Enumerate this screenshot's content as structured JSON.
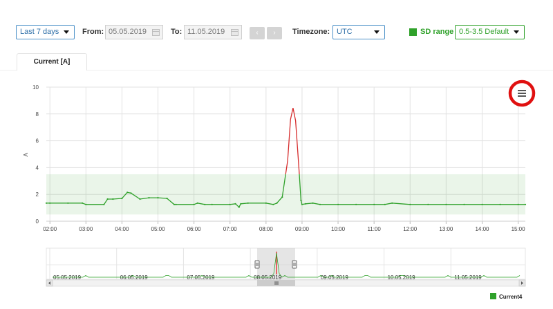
{
  "toolbar": {
    "period": "Last 7 days",
    "from_label": "From:",
    "from_value": "05.05.2019",
    "to_label": "To:",
    "to_value": "11.05.2019",
    "prev": "‹",
    "next": "›",
    "timezone_label": "Timezone:",
    "timezone_value": "UTC",
    "sd_label": "SD range",
    "sd_value": "0.5-3.5 Default",
    "sd_color": "#2fa12a"
  },
  "tab": {
    "label": "Current [A]"
  },
  "chart_data": {
    "type": "line",
    "title": "",
    "xlabel": "",
    "ylabel": "A",
    "x_ticks": [
      "02:00",
      "03:00",
      "04:00",
      "05:00",
      "06:00",
      "07:00",
      "08:00",
      "09:00",
      "10:00",
      "11:00",
      "12:00",
      "13:00",
      "14:00",
      "15:00"
    ],
    "y_ticks": [
      "0",
      "2",
      "4",
      "6",
      "8",
      "10"
    ],
    "xlim": [
      1.9,
      15.2
    ],
    "ylim": [
      0,
      10
    ],
    "grid": true,
    "sd_band": [
      0.5,
      3.5
    ],
    "series": [
      {
        "name": "Current4",
        "color": "#2fa12a",
        "alert_color": "#d62c2c",
        "alert_threshold": 3.5,
        "x": [
          1.9,
          2.0,
          2.5,
          2.9,
          3.0,
          3.5,
          3.6,
          3.75,
          4.0,
          4.15,
          4.25,
          4.5,
          4.75,
          5.0,
          5.25,
          5.45,
          5.5,
          6.0,
          6.1,
          6.3,
          6.5,
          7.0,
          7.15,
          7.25,
          7.3,
          7.5,
          8.0,
          8.2,
          8.3,
          8.45,
          8.6,
          8.68,
          8.75,
          8.82,
          8.9,
          8.97,
          9.0,
          9.1,
          9.3,
          9.5,
          10.0,
          10.5,
          11.0,
          11.3,
          11.5,
          12.0,
          12.5,
          13.0,
          13.5,
          14.0,
          14.5,
          15.0,
          15.2
        ],
        "values": [
          1.35,
          1.35,
          1.35,
          1.35,
          1.25,
          1.25,
          1.65,
          1.65,
          1.7,
          2.15,
          2.1,
          1.65,
          1.75,
          1.75,
          1.7,
          1.25,
          1.25,
          1.25,
          1.35,
          1.25,
          1.25,
          1.25,
          1.3,
          1.05,
          1.3,
          1.35,
          1.35,
          1.25,
          1.35,
          1.8,
          4.5,
          7.6,
          8.45,
          7.5,
          4.5,
          1.55,
          1.25,
          1.3,
          1.35,
          1.25,
          1.25,
          1.25,
          1.25,
          1.25,
          1.35,
          1.25,
          1.25,
          1.25,
          1.25,
          1.25,
          1.25,
          1.25,
          1.25
        ]
      }
    ]
  },
  "navigator": {
    "dates": [
      "05.05.2019",
      "06.05.2019",
      "07.05.2019",
      "08.05.2019",
      "09.05.2019",
      "10.05.2019",
      "11.05.2019"
    ]
  },
  "menu": {
    "icon": "hamburger-menu-icon",
    "highlight_color": "#e01010"
  },
  "legend": {
    "label": "Current4"
  }
}
